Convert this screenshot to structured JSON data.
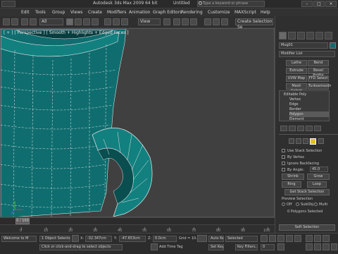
{
  "titlebar": {
    "app_title": "Autodesk 3ds Max 2009 64 bit",
    "find_label": "Untitled",
    "search_placeholder": "Type a keyword or phrase",
    "minimize": "–",
    "maximize": "□",
    "close": "×"
  },
  "menubar": {
    "items": [
      "Edit",
      "Tools",
      "Group",
      "Views",
      "Create",
      "Modifiers",
      "Animation",
      "Graph Editors",
      "Rendering",
      "Customize",
      "MAXScript",
      "Help"
    ]
  },
  "toolbar": {
    "selection_filter": "All",
    "reference_coord": "View",
    "named_selection": "Create Selection Se"
  },
  "viewport": {
    "label": "[ + ] [ Perspective ] [ Smooth + Highlights + Edged Faces ]",
    "colors": {
      "background": "#404040",
      "mug_body": "#0f6d6f",
      "mug_dark": "#0a4e50",
      "edges": "#e8e8e8"
    }
  },
  "command_panel": {
    "object_name": "Mug01",
    "modifier_list": "Modifier List",
    "buttons": [
      "Lathe",
      "Bend",
      "Extrude",
      "Bevel Profile",
      "UVW Map",
      "FFD Select",
      "Mesh Select",
      "Turbosmooth"
    ],
    "stack": [
      "Editable Poly",
      "Vertex",
      "Edge",
      "Border",
      "Polygon",
      "Element"
    ],
    "selected_stack_item": "Polygon",
    "options": [
      "Use Stack Selection",
      "By Vertex",
      "Ignore Backfacing",
      "By Angle:"
    ],
    "by_angle_value": "45.0",
    "shrink": "Shrink",
    "grow": "Grow",
    "ring": "Ring",
    "loop": "Loop",
    "get_stack_selection": "Get Stack Selection",
    "preview_selection": "Preview Selection",
    "preview_options": [
      "Off",
      "SubObj",
      "Multi"
    ],
    "polygons_selected": "0 Polygons Selected",
    "soft_selection": "Soft Selection"
  },
  "timeline": {
    "frame": "0 / 100",
    "ticks": [
      "0",
      "10",
      "20",
      "30",
      "40",
      "50",
      "60",
      "70",
      "80",
      "90",
      "100"
    ]
  },
  "statusbar": {
    "objects_selected": "1 Object Selected",
    "prompt": "Click or click-and-drag to select objects",
    "welcome": "Welcome to M",
    "x_label": "X:",
    "x_value": "-32.347cm",
    "y_label": "Y:",
    "y_value": "-47.653cm",
    "z_label": "Z:",
    "z_value": "0.0cm",
    "grid": "Grid = 10.0cm",
    "add_time_tag": "Add Time Tag",
    "auto_key": "Auto Key",
    "set_key": "Set Key",
    "key_mode": "Selected",
    "key_filters": "Key Filters...",
    "current_frame": "0"
  }
}
